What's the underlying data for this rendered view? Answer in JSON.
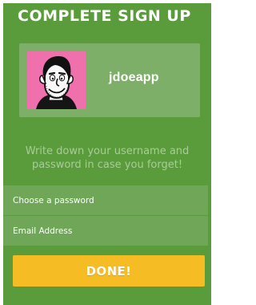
{
  "header": {
    "title": "COMPLETE SIGN UP"
  },
  "profile": {
    "username": "jdoeapp",
    "avatar_icon": "cartoon-man-avatar",
    "avatar_background": "#f06fad"
  },
  "hint": {
    "text": "Write down your username and password in case you forget!"
  },
  "form": {
    "password_placeholder": "Choose a password",
    "email_placeholder": "Email Address",
    "done_label": "DONE!"
  },
  "colors": {
    "background": "#5a9b3b",
    "card": "#7eaf68",
    "field": "#6fa657",
    "button": "#f5bd23",
    "hint_text": "#a9cc98"
  }
}
